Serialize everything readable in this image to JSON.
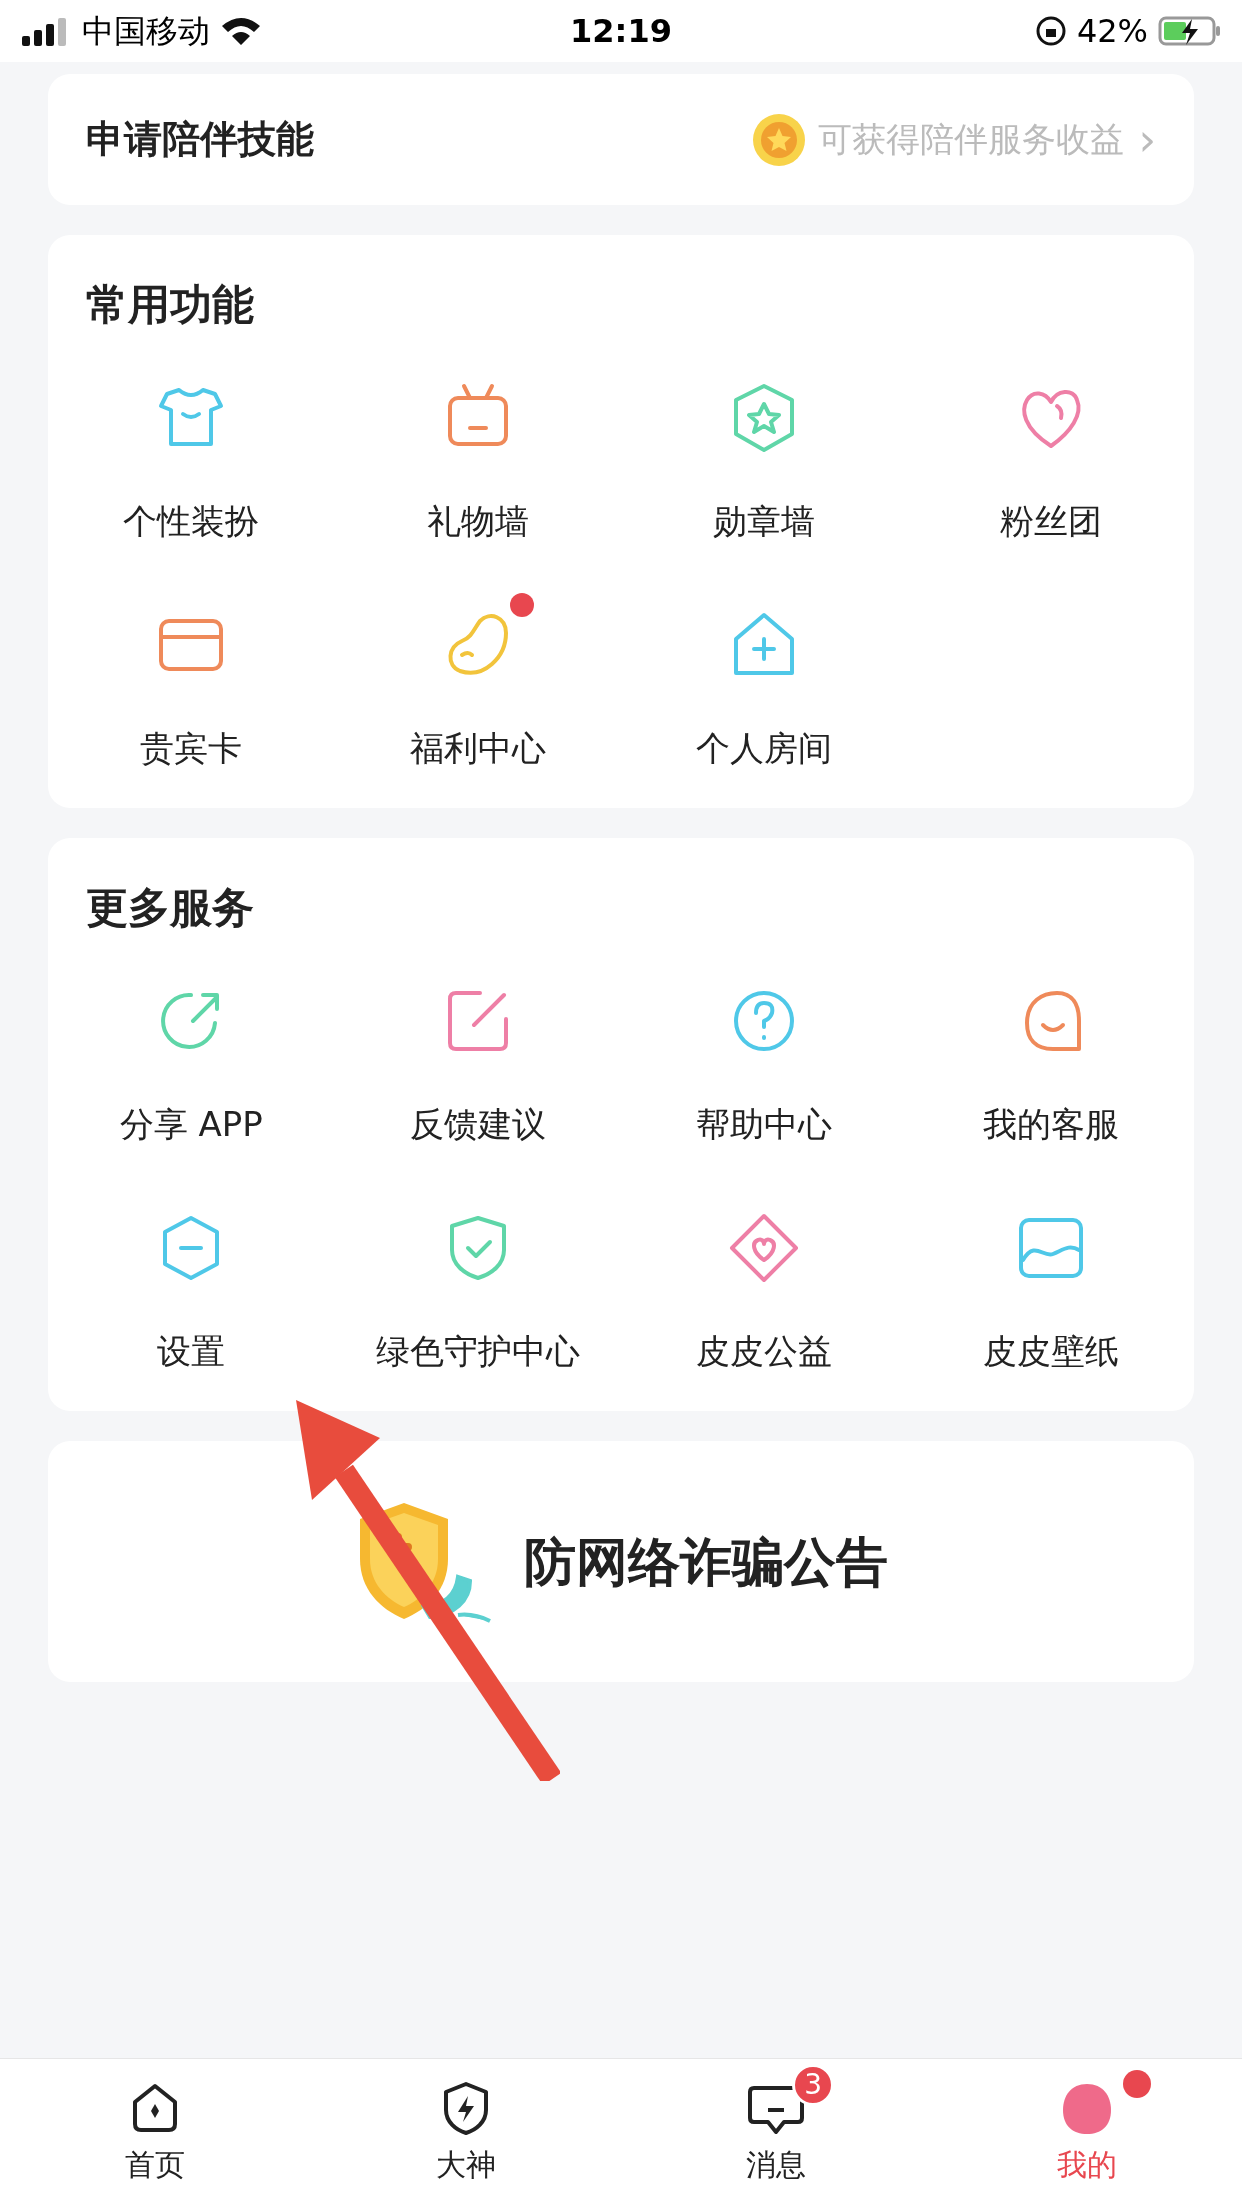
{
  "status_bar": {
    "carrier": "中国移动",
    "time": "12:19",
    "battery": "42%"
  },
  "apply_card": {
    "title": "申请陪伴技能",
    "hint": "可获得陪伴服务收益",
    "chevron": "›"
  },
  "sections": [
    {
      "title": "常用功能",
      "items": [
        {
          "label": "个性装扮",
          "kind": "shirt",
          "color": "#4fc8e8",
          "dot": false
        },
        {
          "label": "礼物墙",
          "kind": "tv",
          "color": "#ef8a5a",
          "dot": false
        },
        {
          "label": "勋章墙",
          "kind": "badge",
          "color": "#5fd6a8",
          "dot": false
        },
        {
          "label": "粉丝团",
          "kind": "heart",
          "color": "#ee7fa6",
          "dot": false
        },
        {
          "label": "贵宾卡",
          "kind": "card",
          "color": "#ef8a5a",
          "dot": false
        },
        {
          "label": "福利中心",
          "kind": "bean",
          "color": "#f2c43c",
          "dot": true
        },
        {
          "label": "个人房间",
          "kind": "house",
          "color": "#4fc8e8",
          "dot": false
        }
      ]
    },
    {
      "title": "更多服务",
      "items": [
        {
          "label": "分享 APP",
          "kind": "share",
          "color": "#5fd6a8",
          "dot": false
        },
        {
          "label": "反馈建议",
          "kind": "edit",
          "color": "#ee7fa6",
          "dot": false
        },
        {
          "label": "帮助中心",
          "kind": "help",
          "color": "#4fc8e8",
          "dot": false
        },
        {
          "label": "我的客服",
          "kind": "smile",
          "color": "#ef8a5a",
          "dot": false
        },
        {
          "label": "设置",
          "kind": "hex",
          "color": "#4fc8e8",
          "dot": false
        },
        {
          "label": "绿色守护中心",
          "kind": "shield",
          "color": "#5fd6a8",
          "dot": false
        },
        {
          "label": "皮皮公益",
          "kind": "diamond",
          "color": "#ee7fa6",
          "dot": false
        },
        {
          "label": "皮皮壁纸",
          "kind": "wallpaper",
          "color": "#4fc8e8",
          "dot": false
        }
      ]
    }
  ],
  "notice": {
    "title": "防网络诈骗公告"
  },
  "tab_bar": [
    {
      "label": "首页",
      "kind": "home",
      "selected": false,
      "dot": false
    },
    {
      "label": "大神",
      "kind": "bolt",
      "selected": false,
      "dot": false
    },
    {
      "label": "消息",
      "kind": "chat",
      "selected": false,
      "badge": "3",
      "dot": false
    },
    {
      "label": "我的",
      "kind": "me",
      "selected": true,
      "dot": true
    }
  ]
}
